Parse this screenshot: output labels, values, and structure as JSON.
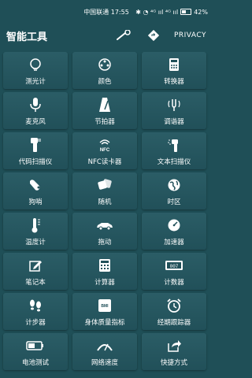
{
  "status": {
    "carrier_time": "中国联通 17:55",
    "icons": "✱ ◔ ⁴ᴳ ııl ⁴ᴳ ııl",
    "battery": "42%"
  },
  "toolbar": {
    "title": "智能工具",
    "privacy": "PRIVACY"
  },
  "tools": [
    {
      "label": "测光计",
      "icon": "light-meter-icon"
    },
    {
      "label": "颜色",
      "icon": "color-icon"
    },
    {
      "label": "转换器",
      "icon": "converter-icon"
    },
    {
      "label": "麦克风",
      "icon": "microphone-icon"
    },
    {
      "label": "节拍器",
      "icon": "metronome-icon"
    },
    {
      "label": "调谐器",
      "icon": "tuner-icon"
    },
    {
      "label": "代码扫描仪",
      "icon": "barcode-scanner-icon"
    },
    {
      "label": "NFC读卡器",
      "icon": "nfc-icon"
    },
    {
      "label": "文本扫描仪",
      "icon": "text-scanner-icon"
    },
    {
      "label": "狗哨",
      "icon": "dog-whistle-icon"
    },
    {
      "label": "随机",
      "icon": "dice-icon"
    },
    {
      "label": "时区",
      "icon": "globe-icon"
    },
    {
      "label": "温度计",
      "icon": "thermometer-icon"
    },
    {
      "label": "拖动",
      "icon": "car-icon"
    },
    {
      "label": "加速器",
      "icon": "speedometer-icon"
    },
    {
      "label": "笔记本",
      "icon": "notebook-icon"
    },
    {
      "label": "计算器",
      "icon": "calculator-icon"
    },
    {
      "label": "计数器",
      "icon": "counter-icon"
    },
    {
      "label": "计步器",
      "icon": "footsteps-icon"
    },
    {
      "label": "身体质量指标",
      "icon": "bmi-scale-icon"
    },
    {
      "label": "经期跟踪器",
      "icon": "alarm-clock-icon"
    },
    {
      "label": "电池测试",
      "icon": "battery-icon"
    },
    {
      "label": "网络速度",
      "icon": "network-speed-icon"
    },
    {
      "label": "快捷方式",
      "icon": "shortcut-icon"
    }
  ]
}
